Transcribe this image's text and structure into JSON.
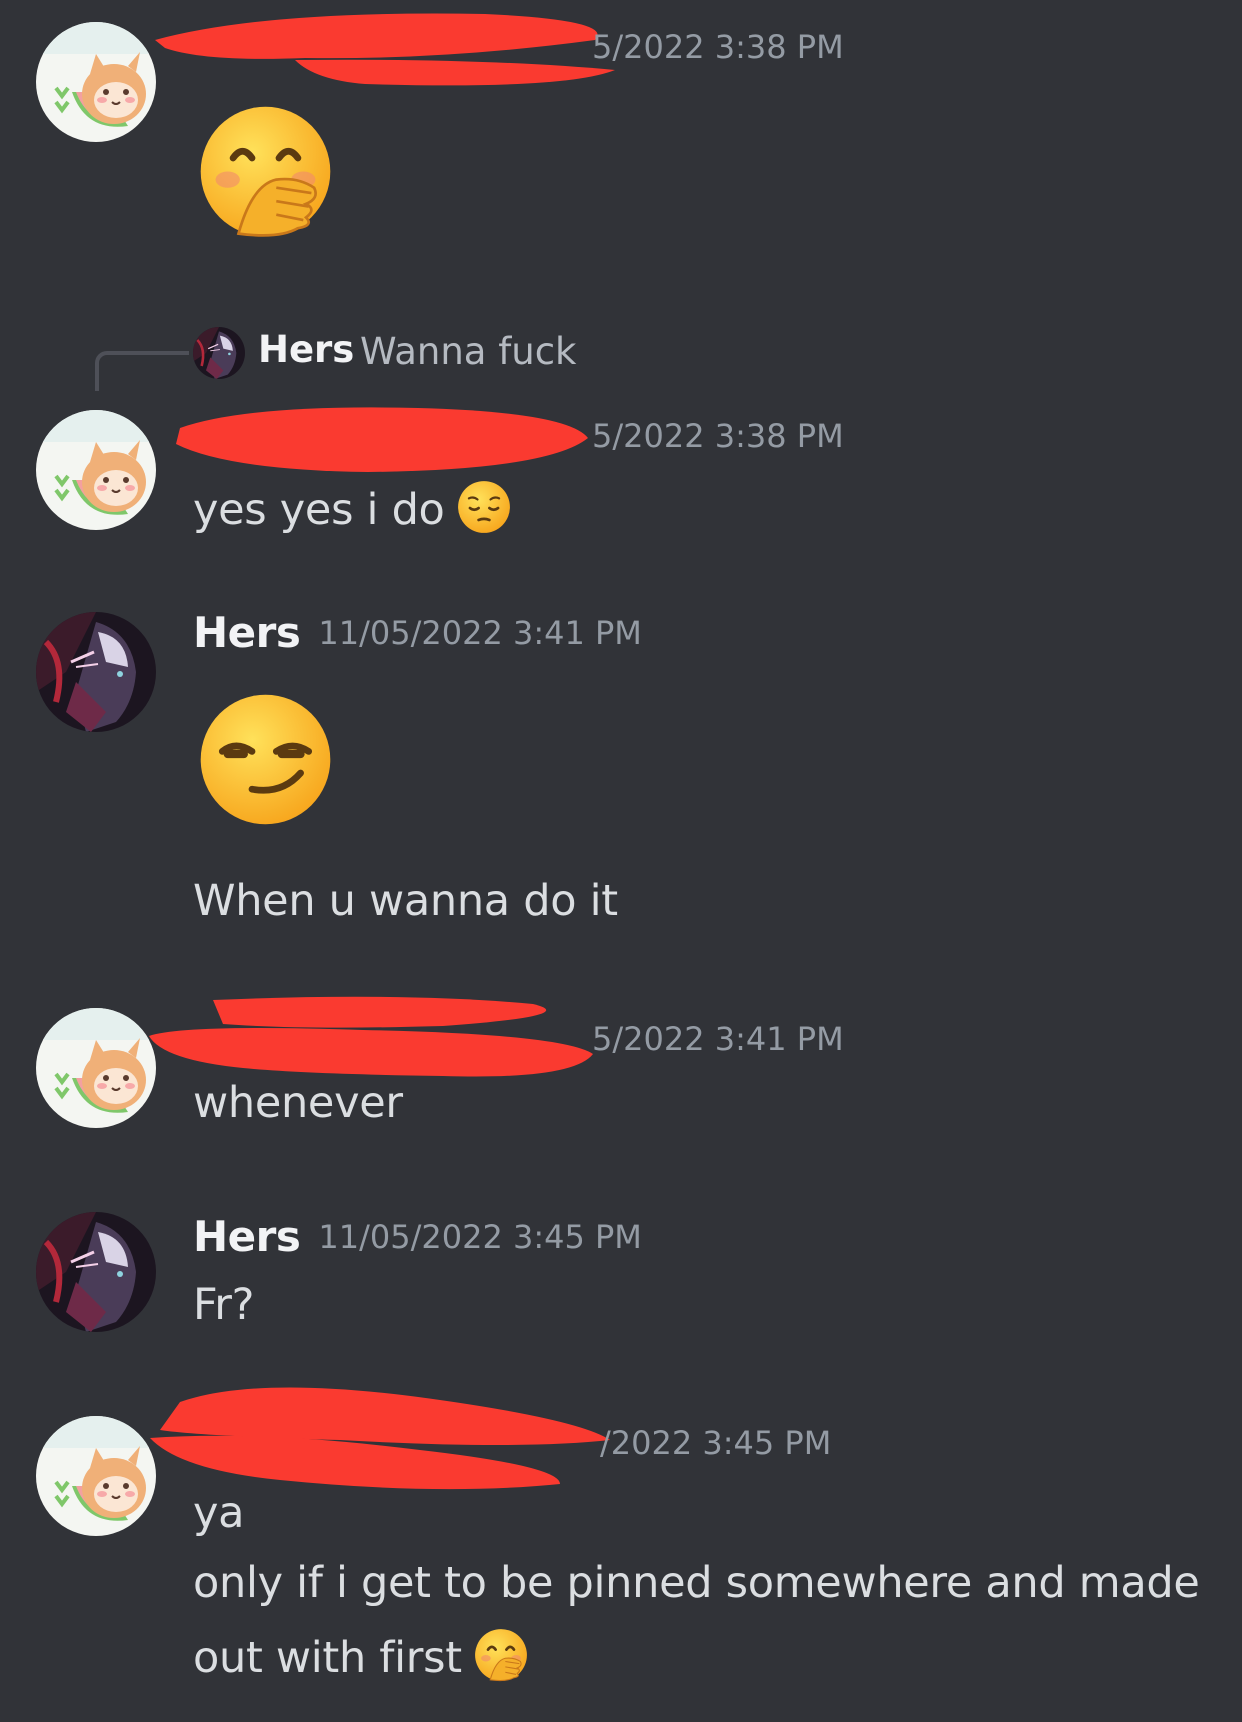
{
  "colors": {
    "background": "#313338",
    "text": "#dbdee1",
    "muted": "#949ba4",
    "redaction": "#fa3a30"
  },
  "messages": [
    {
      "author_redacted": true,
      "avatar": "cat-watermelon-avatar",
      "timestamp_visible": "5/2022 3:38 PM",
      "big_emoji": "hand-over-mouth-emoji"
    },
    {
      "reply": {
        "author": "Hers",
        "content": "Wanna fuck"
      },
      "author_redacted": true,
      "avatar": "cat-watermelon-avatar",
      "timestamp_visible": "5/2022 3:38 PM",
      "text": "yes yes i do",
      "inline_emoji": "pensive-emoji"
    },
    {
      "author": "Hers",
      "avatar": "anime-character-avatar",
      "timestamp": "11/05/2022 3:41 PM",
      "big_emoji": "smirking-face-emoji",
      "text": "When u wanna do it"
    },
    {
      "author_redacted": true,
      "avatar": "cat-watermelon-avatar",
      "timestamp_visible": "5/2022 3:41 PM",
      "text": "whenever"
    },
    {
      "author": "Hers",
      "avatar": "anime-character-avatar",
      "timestamp": "11/05/2022 3:45 PM",
      "text": "Fr?"
    },
    {
      "author_redacted": true,
      "avatar": "cat-watermelon-avatar",
      "timestamp_visible": "/2022 3:45 PM",
      "lines": [
        "ya",
        "only if i get to be pinned somewhere and made",
        "out with first"
      ],
      "inline_emoji": "hand-over-mouth-emoji"
    }
  ]
}
